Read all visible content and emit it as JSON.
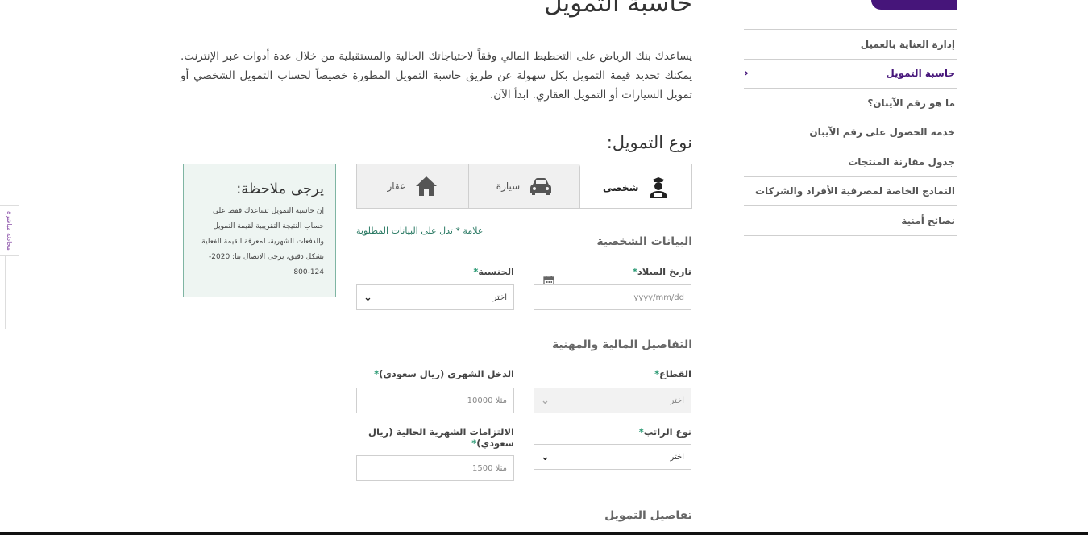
{
  "page": {
    "title": "حاسبة التمويل",
    "intro": "يساعدك بنك الرياض على التخطيط المالي وفقاً لاحتياجاتك الحالية والمستقبلية من خلال عدة أدوات عبر الإنترنت. يمكنك تحديد قيمة التمويل بكل سهولة عن طريق حاسبة التمويل المطورة خصيصاً لحساب التمويل الشخصي أو تمويل السيارات أو التمويل العقاري. ابدأ الآن.",
    "finance_type_title": "نوع التمويل:"
  },
  "sidebar": {
    "items": [
      {
        "label": "إدارة العناية بالعميل"
      },
      {
        "label": "حاسبة التمويل"
      },
      {
        "label": "ما هو رقم الآيبان؟"
      },
      {
        "label": "خدمة الحصول على رقم الآيبان"
      },
      {
        "label": "جدول مقارنة المنتجات"
      },
      {
        "label": "النماذج الخاصة لمصرفية الأفراد والشركات"
      },
      {
        "label": "نصائح أمنية"
      }
    ]
  },
  "tabs": [
    {
      "label": "شخصي",
      "icon": "person-icon"
    },
    {
      "label": "سيارة",
      "icon": "car-icon"
    },
    {
      "label": "عقار",
      "icon": "house-icon"
    }
  ],
  "form": {
    "required_note": "علامة * تدل على البيانات المطلوبة",
    "personal_section": "البيانات الشخصية",
    "financial_section": "التفاصيل المالية والمهنية",
    "finance_details_section": "تفاصيل التمويل",
    "birth_date": {
      "label": "تاريخ الميلاد",
      "placeholder": "yyyy/mm/dd"
    },
    "nationality": {
      "label": "الجنسية",
      "value": "اختر"
    },
    "sector": {
      "label": "القطاع",
      "value": "اختر"
    },
    "monthly_income": {
      "label": "الدخل الشهري (ريال سعودي)",
      "placeholder": "مثلا 10000"
    },
    "salary_type": {
      "label": "نوع الراتب",
      "value": "اختر"
    },
    "monthly_obligations": {
      "label": "الالتزامات الشهرية الحالية (ريال سعودي)",
      "placeholder": "مثلا 1500"
    }
  },
  "note_box": {
    "title": "يرجى ملاحظة:",
    "text": "إن حاسبة التمويل تساعدك فقط على حساب النتيجة التقريبية لقيمة التمويل والدفعات الشهرية، لمعرفة القيمة الفعلية بشكل دقيق، يرجى الاتصال بنا: 2020-124-800"
  },
  "feedback_tab": {
    "label": "محادثة مباشرة"
  },
  "colors": {
    "brand": "#46157a",
    "accent": "#2b9a74"
  }
}
